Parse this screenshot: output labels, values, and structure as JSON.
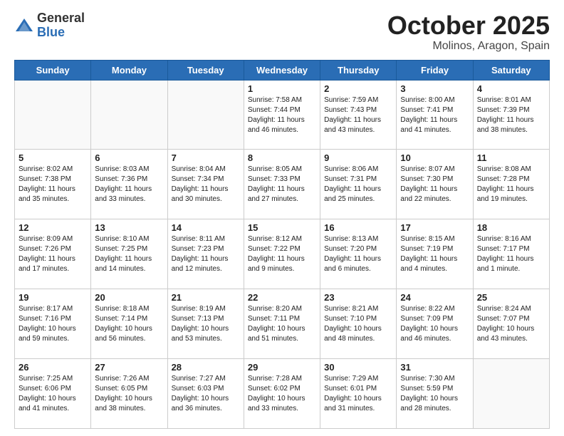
{
  "logo": {
    "general": "General",
    "blue": "Blue"
  },
  "title": "October 2025",
  "location": "Molinos, Aragon, Spain",
  "days_of_week": [
    "Sunday",
    "Monday",
    "Tuesday",
    "Wednesday",
    "Thursday",
    "Friday",
    "Saturday"
  ],
  "weeks": [
    [
      {
        "day": "",
        "info": ""
      },
      {
        "day": "",
        "info": ""
      },
      {
        "day": "",
        "info": ""
      },
      {
        "day": "1",
        "info": "Sunrise: 7:58 AM\nSunset: 7:44 PM\nDaylight: 11 hours\nand 46 minutes."
      },
      {
        "day": "2",
        "info": "Sunrise: 7:59 AM\nSunset: 7:43 PM\nDaylight: 11 hours\nand 43 minutes."
      },
      {
        "day": "3",
        "info": "Sunrise: 8:00 AM\nSunset: 7:41 PM\nDaylight: 11 hours\nand 41 minutes."
      },
      {
        "day": "4",
        "info": "Sunrise: 8:01 AM\nSunset: 7:39 PM\nDaylight: 11 hours\nand 38 minutes."
      }
    ],
    [
      {
        "day": "5",
        "info": "Sunrise: 8:02 AM\nSunset: 7:38 PM\nDaylight: 11 hours\nand 35 minutes."
      },
      {
        "day": "6",
        "info": "Sunrise: 8:03 AM\nSunset: 7:36 PM\nDaylight: 11 hours\nand 33 minutes."
      },
      {
        "day": "7",
        "info": "Sunrise: 8:04 AM\nSunset: 7:34 PM\nDaylight: 11 hours\nand 30 minutes."
      },
      {
        "day": "8",
        "info": "Sunrise: 8:05 AM\nSunset: 7:33 PM\nDaylight: 11 hours\nand 27 minutes."
      },
      {
        "day": "9",
        "info": "Sunrise: 8:06 AM\nSunset: 7:31 PM\nDaylight: 11 hours\nand 25 minutes."
      },
      {
        "day": "10",
        "info": "Sunrise: 8:07 AM\nSunset: 7:30 PM\nDaylight: 11 hours\nand 22 minutes."
      },
      {
        "day": "11",
        "info": "Sunrise: 8:08 AM\nSunset: 7:28 PM\nDaylight: 11 hours\nand 19 minutes."
      }
    ],
    [
      {
        "day": "12",
        "info": "Sunrise: 8:09 AM\nSunset: 7:26 PM\nDaylight: 11 hours\nand 17 minutes."
      },
      {
        "day": "13",
        "info": "Sunrise: 8:10 AM\nSunset: 7:25 PM\nDaylight: 11 hours\nand 14 minutes."
      },
      {
        "day": "14",
        "info": "Sunrise: 8:11 AM\nSunset: 7:23 PM\nDaylight: 11 hours\nand 12 minutes."
      },
      {
        "day": "15",
        "info": "Sunrise: 8:12 AM\nSunset: 7:22 PM\nDaylight: 11 hours\nand 9 minutes."
      },
      {
        "day": "16",
        "info": "Sunrise: 8:13 AM\nSunset: 7:20 PM\nDaylight: 11 hours\nand 6 minutes."
      },
      {
        "day": "17",
        "info": "Sunrise: 8:15 AM\nSunset: 7:19 PM\nDaylight: 11 hours\nand 4 minutes."
      },
      {
        "day": "18",
        "info": "Sunrise: 8:16 AM\nSunset: 7:17 PM\nDaylight: 11 hours\nand 1 minute."
      }
    ],
    [
      {
        "day": "19",
        "info": "Sunrise: 8:17 AM\nSunset: 7:16 PM\nDaylight: 10 hours\nand 59 minutes."
      },
      {
        "day": "20",
        "info": "Sunrise: 8:18 AM\nSunset: 7:14 PM\nDaylight: 10 hours\nand 56 minutes."
      },
      {
        "day": "21",
        "info": "Sunrise: 8:19 AM\nSunset: 7:13 PM\nDaylight: 10 hours\nand 53 minutes."
      },
      {
        "day": "22",
        "info": "Sunrise: 8:20 AM\nSunset: 7:11 PM\nDaylight: 10 hours\nand 51 minutes."
      },
      {
        "day": "23",
        "info": "Sunrise: 8:21 AM\nSunset: 7:10 PM\nDaylight: 10 hours\nand 48 minutes."
      },
      {
        "day": "24",
        "info": "Sunrise: 8:22 AM\nSunset: 7:09 PM\nDaylight: 10 hours\nand 46 minutes."
      },
      {
        "day": "25",
        "info": "Sunrise: 8:24 AM\nSunset: 7:07 PM\nDaylight: 10 hours\nand 43 minutes."
      }
    ],
    [
      {
        "day": "26",
        "info": "Sunrise: 7:25 AM\nSunset: 6:06 PM\nDaylight: 10 hours\nand 41 minutes."
      },
      {
        "day": "27",
        "info": "Sunrise: 7:26 AM\nSunset: 6:05 PM\nDaylight: 10 hours\nand 38 minutes."
      },
      {
        "day": "28",
        "info": "Sunrise: 7:27 AM\nSunset: 6:03 PM\nDaylight: 10 hours\nand 36 minutes."
      },
      {
        "day": "29",
        "info": "Sunrise: 7:28 AM\nSunset: 6:02 PM\nDaylight: 10 hours\nand 33 minutes."
      },
      {
        "day": "30",
        "info": "Sunrise: 7:29 AM\nSunset: 6:01 PM\nDaylight: 10 hours\nand 31 minutes."
      },
      {
        "day": "31",
        "info": "Sunrise: 7:30 AM\nSunset: 5:59 PM\nDaylight: 10 hours\nand 28 minutes."
      },
      {
        "day": "",
        "info": ""
      }
    ]
  ]
}
